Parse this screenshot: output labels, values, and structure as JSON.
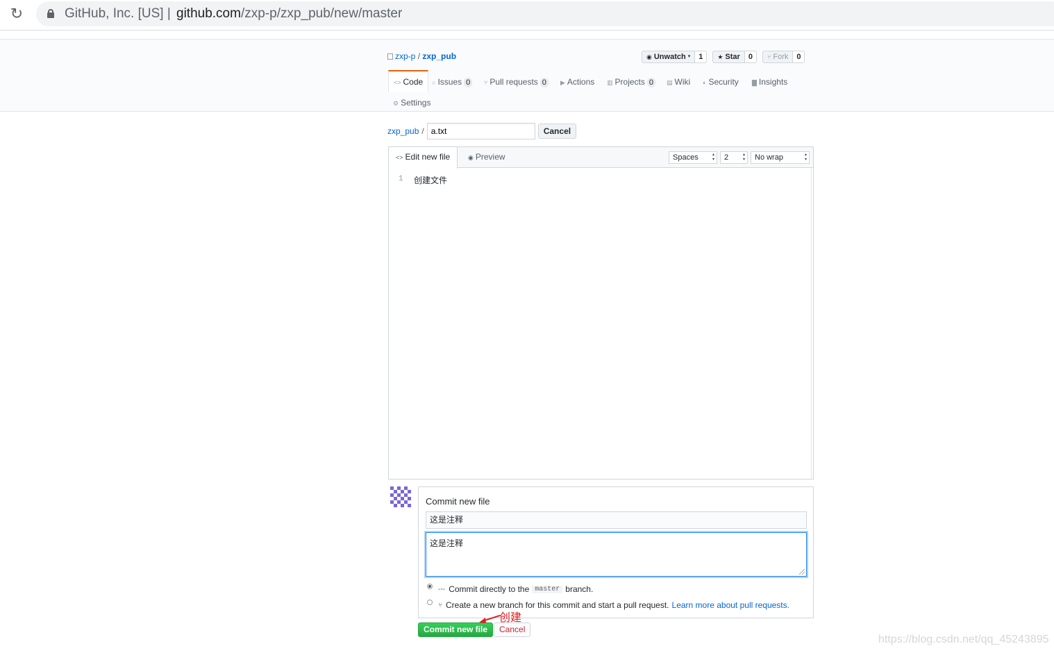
{
  "browser": {
    "org": "GitHub, Inc. [US]",
    "separator": "|",
    "url_host": "github.com",
    "url_path": "/zxp-p/zxp_pub/new/master"
  },
  "repo": {
    "owner": "zxp-p",
    "slash": "/",
    "name": "zxp_pub",
    "actions": {
      "watch_label": "Unwatch",
      "watch_count": "1",
      "star_label": "Star",
      "star_count": "0",
      "fork_label": "Fork",
      "fork_count": "0"
    },
    "tabs": [
      {
        "label": "Code",
        "icon": "code-icon"
      },
      {
        "label": "Issues",
        "count": "0",
        "icon": "issue-icon"
      },
      {
        "label": "Pull requests",
        "count": "0",
        "icon": "pull-request-icon"
      },
      {
        "label": "Actions",
        "icon": "play-icon"
      },
      {
        "label": "Projects",
        "count": "0",
        "icon": "project-icon"
      },
      {
        "label": "Wiki",
        "icon": "book-icon"
      },
      {
        "label": "Security",
        "icon": "shield-icon"
      },
      {
        "label": "Insights",
        "icon": "graph-icon"
      },
      {
        "label": "Settings",
        "icon": "gear-icon"
      }
    ]
  },
  "file_nav": {
    "repo_link": "zxp_pub",
    "separator": "/",
    "filename_value": "a.txt",
    "cancel_label": "Cancel"
  },
  "editor": {
    "tab_edit": "Edit new file",
    "tab_preview": "Preview",
    "indent_mode": "Spaces",
    "indent_size": "2",
    "wrap_mode": "No wrap",
    "line_number": "1",
    "content": "创建文件"
  },
  "commit": {
    "title": "Commit new file",
    "summary_value": "这是注释",
    "description_value": "这是注释",
    "option_direct_prefix": "Commit directly to the",
    "option_direct_branch": "master",
    "option_direct_suffix": "branch.",
    "option_new_prefix": "Create a",
    "option_new_bold": "new branch",
    "option_new_suffix": "for this commit and start a pull request.",
    "option_new_link": "Learn more about pull requests.",
    "submit_label": "Commit new file",
    "cancel_label": "Cancel"
  },
  "annotation": {
    "text": "创建",
    "color": "#e02020"
  },
  "watermark": "https://blog.csdn.net/qq_45243895",
  "colors": {
    "link": "#0366d6",
    "commit_green": "#28a745",
    "active_tab_accent": "#e36209",
    "cancel_red": "#cb2431"
  }
}
